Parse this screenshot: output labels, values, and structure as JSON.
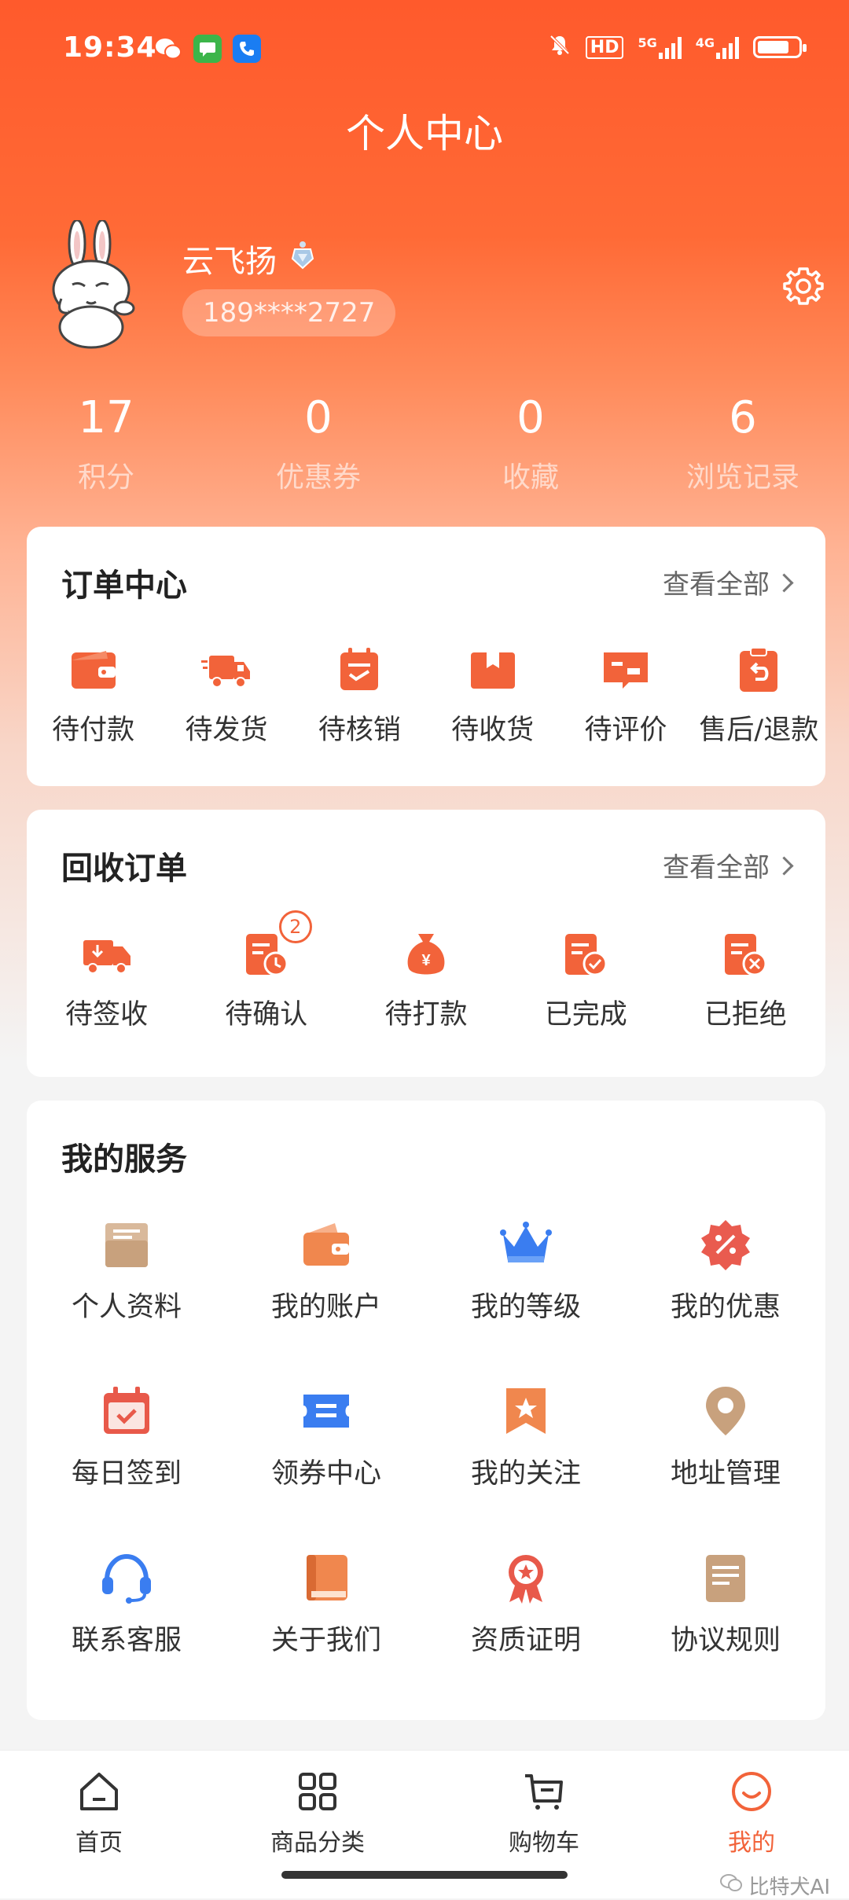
{
  "status_bar": {
    "time": "19:34",
    "network_labels": [
      "HD",
      "5G",
      "4G"
    ]
  },
  "header": {
    "title": "个人中心"
  },
  "profile": {
    "name": "云飞扬",
    "phone": "189****2727"
  },
  "stats": [
    {
      "value": "17",
      "label": "积分"
    },
    {
      "value": "0",
      "label": "优惠券"
    },
    {
      "value": "0",
      "label": "收藏"
    },
    {
      "value": "6",
      "label": "浏览记录"
    }
  ],
  "order_center": {
    "title": "订单中心",
    "view_all": "查看全部",
    "items": [
      {
        "label": "待付款",
        "icon": "wallet-icon"
      },
      {
        "label": "待发货",
        "icon": "truck-icon"
      },
      {
        "label": "待核销",
        "icon": "calendar-check-icon"
      },
      {
        "label": "待收货",
        "icon": "box-icon"
      },
      {
        "label": "待评价",
        "icon": "comment-icon"
      },
      {
        "label": "售后/退款",
        "icon": "refund-icon"
      }
    ]
  },
  "recycle_orders": {
    "title": "回收订单",
    "view_all": "查看全部",
    "items": [
      {
        "label": "待签收",
        "icon": "delivery-truck-icon"
      },
      {
        "label": "待确认",
        "icon": "doc-clock-icon",
        "badge": "2"
      },
      {
        "label": "待打款",
        "icon": "money-bag-icon"
      },
      {
        "label": "已完成",
        "icon": "doc-check-icon"
      },
      {
        "label": "已拒绝",
        "icon": "doc-reject-icon"
      }
    ]
  },
  "services": {
    "title": "我的服务",
    "items": [
      {
        "label": "个人资料",
        "icon": "profile-box-icon"
      },
      {
        "label": "我的账户",
        "icon": "wallet-icon"
      },
      {
        "label": "我的等级",
        "icon": "crown-icon"
      },
      {
        "label": "我的优惠",
        "icon": "discount-badge-icon"
      },
      {
        "label": "每日签到",
        "icon": "calendar-checkin-icon"
      },
      {
        "label": "领券中心",
        "icon": "coupon-icon"
      },
      {
        "label": "我的关注",
        "icon": "star-bookmark-icon"
      },
      {
        "label": "地址管理",
        "icon": "location-pin-icon"
      },
      {
        "label": "联系客服",
        "icon": "headset-icon"
      },
      {
        "label": "关于我们",
        "icon": "book-icon"
      },
      {
        "label": "资质证明",
        "icon": "award-medal-icon"
      },
      {
        "label": "协议规则",
        "icon": "document-icon"
      }
    ]
  },
  "tabbar": [
    {
      "label": "首页",
      "icon": "home-icon"
    },
    {
      "label": "商品分类",
      "icon": "grid-icon"
    },
    {
      "label": "购物车",
      "icon": "cart-icon"
    },
    {
      "label": "我的",
      "icon": "smile-icon",
      "active": true
    }
  ],
  "watermark": "比特犬AI",
  "colors": {
    "accent": "#f2633a",
    "header_gradient_top": "#ff5a2c"
  }
}
